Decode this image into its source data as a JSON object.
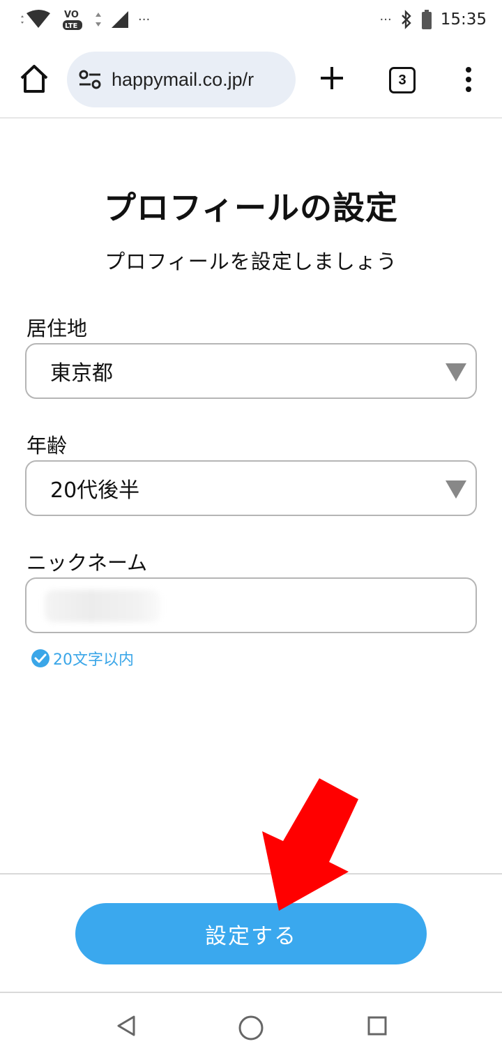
{
  "status_bar": {
    "time": "15:35",
    "lte_badge": "LTE",
    "vo_badge": "VO",
    "overflow_left": "···",
    "overflow_right": "···"
  },
  "browser": {
    "url": "happymail.co.jp/r",
    "tab_count": "3"
  },
  "page": {
    "title": "プロフィールの設定",
    "subtitle": "プロフィールを設定しましょう"
  },
  "form": {
    "residence": {
      "label": "居住地",
      "value": "東京都"
    },
    "age": {
      "label": "年齢",
      "value": "20代後半"
    },
    "nickname": {
      "label": "ニックネーム",
      "hint": "20文字以内"
    }
  },
  "submit": {
    "label": "設定する"
  },
  "colors": {
    "accent": "#3aa8ee",
    "annotation_arrow": "#ff0000",
    "url_pill": "#e9eef6"
  },
  "icons": {
    "home": "home-icon",
    "site_settings": "tune-icon",
    "new_tab": "plus-icon",
    "menu": "more-vert-icon",
    "select": "triangle-down-icon",
    "hint": "check-circle-icon",
    "nav_back": "back-triangle-icon",
    "nav_home": "circle-home-icon",
    "nav_recent": "square-recents-icon"
  }
}
